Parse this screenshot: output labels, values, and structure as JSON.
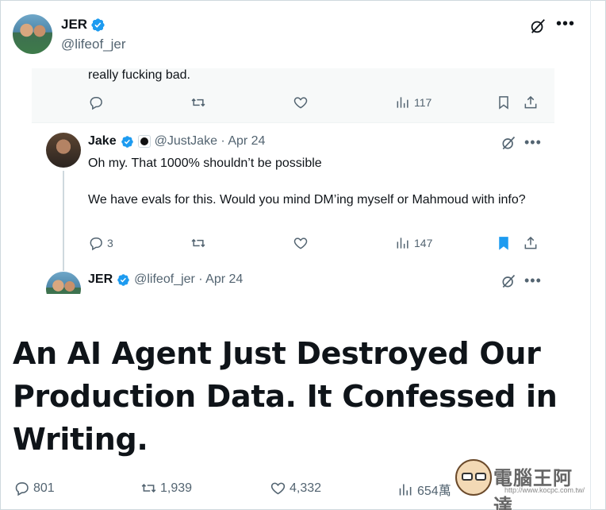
{
  "author": {
    "name": "JER",
    "handle": "@lifeof_jer"
  },
  "embedded": {
    "previous_text": "really fucking bad.",
    "previous_actions": {
      "views": "117"
    },
    "reply": {
      "name": "Jake",
      "handle_date": "@JustJake · Apr 24",
      "text_line1": "Oh my. That 1000% shouldn’t be possible",
      "text_line2": "We have evals for this. Would you mind DM’ing myself or Mahmoud with info?",
      "actions": {
        "replies": "3",
        "views": "147"
      }
    },
    "next_reply": {
      "name": "JER",
      "handle_date": "@lifeof_jer · Apr 24"
    }
  },
  "headline": "An AI Agent Just Destroyed Our Production Data. It Confessed in Writing.",
  "metrics": {
    "replies": "801",
    "reposts": "1,939",
    "likes": "4,332",
    "views": "654萬"
  },
  "watermark": {
    "text": "電腦王阿達",
    "url": "http://www.kocpc.com.tw/"
  },
  "colors": {
    "verified": "#1d9bf0",
    "bookmark_active": "#1d9bf0",
    "text_primary": "#0f1419",
    "text_secondary": "#536471"
  }
}
